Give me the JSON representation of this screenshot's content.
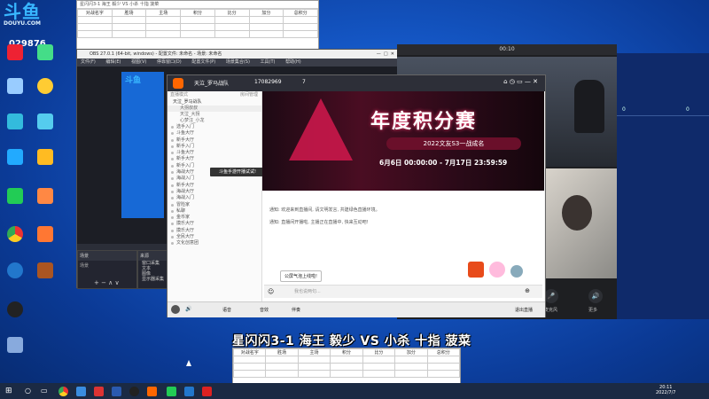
{
  "desktop": {
    "logo": {
      "main": "斗鱼",
      "sub": "DOUYU.COM"
    },
    "counter": "029876"
  },
  "sheet_top": {
    "title": "星闪闪3-1 海王 毅少 VS 小杀 十指 菠菜",
    "headers": [
      "对战名字",
      "胜场",
      "主场",
      "积分",
      "比分",
      "加分",
      "总积分"
    ]
  },
  "sheet_bottom": {
    "headers": [
      "对战名字",
      "胜场",
      "主场",
      "积分",
      "比分",
      "加分",
      "总积分"
    ]
  },
  "obs": {
    "title": "OBS 27.0.1 (64-bit, windows) - 配置文件: 未命名 - 场景: 未命名",
    "menu": [
      "文件(F)",
      "编辑(E)",
      "视图(V)",
      "停靠窗口(D)",
      "配置文件(P)",
      "场景集合(S)",
      "工具(T)",
      "帮助(H)"
    ],
    "dock_scenes_label": "场景",
    "dock_sources_label": "来源",
    "sources": [
      "窗口采集",
      "文本",
      "图像",
      "显示器采集",
      "音频输入"
    ]
  },
  "douyu": {
    "top": {
      "room_name": "天泣_罗马战队",
      "room_id": "17082969",
      "fans": "7"
    },
    "left": {
      "header": "直播模式",
      "right_header": "房间管理",
      "group": "天泣_罗马战队",
      "members": [
        "大拐叔叔",
        "天泣_大拐",
        "心梦汪_小龙"
      ],
      "lobbies": [
        "选手入门",
        "斗鱼大厅",
        "新手大厅",
        "新手入门",
        "斗鱼大厅",
        "新手大厅",
        "新手入门",
        "海战大厅",
        "海战入门",
        "新手大厅",
        "海战大厅",
        "海战入门",
        "冒险家",
        "私聊",
        "金币家",
        "摸乐大厅",
        "摸乐大厅",
        "全民大厅",
        "文化创意团"
      ],
      "tooltip": "斗鱼手游开播试试!"
    },
    "banner": {
      "title": "年度积分赛",
      "sub": "2022文友S3一战成名",
      "dates": "6月6日 00:00:00 - 7月17日 23:59:59"
    },
    "chat": {
      "msg1": "通知: 欢迎来到直播间, 请文明发言, 共建绿色直播环境。",
      "msg2": "通知: 直播间开播啦, 主播正在直播中, 快来互动吧!",
      "popup": "公屏气泡上线啦!",
      "input_placeholder": "我也说两句..."
    },
    "bottom": [
      "语音",
      "音效",
      "伴奏",
      "开启直播",
      "弹幕"
    ],
    "bottom_right": "退出直播"
  },
  "video": {
    "time": "00:10",
    "controls": [
      "静音",
      "麦克风",
      "关闭视频",
      "挂断",
      "更多"
    ],
    "panel": {
      "count1": "0",
      "count2": "0"
    }
  },
  "caption": "星闪闪3-1 海王 毅少 VS 小杀 十指 菠菜",
  "taskbar": {
    "time": "20:11",
    "date": "2022/7/7"
  }
}
